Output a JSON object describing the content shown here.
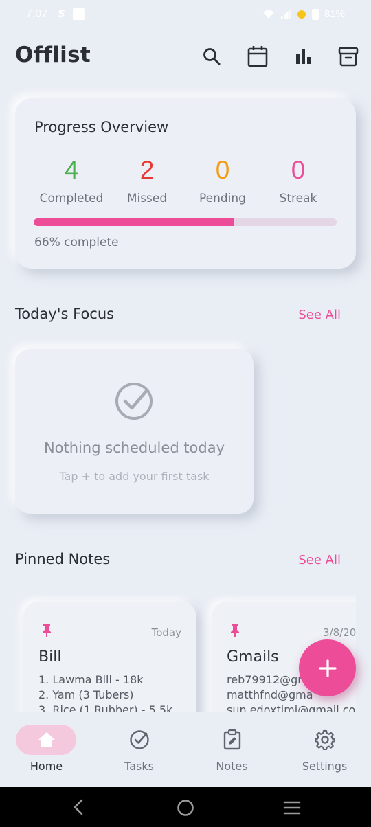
{
  "status_bar": {
    "time": "7:07",
    "battery": "81%"
  },
  "app": {
    "title": "Offlist"
  },
  "progress": {
    "title": "Progress Overview",
    "stats": [
      {
        "value": "4",
        "label": "Completed",
        "color": "#4CAF50"
      },
      {
        "value": "2",
        "label": "Missed",
        "color": "#E53935"
      },
      {
        "value": "0",
        "label": "Pending",
        "color": "#F39C12"
      },
      {
        "value": "0",
        "label": "Streak",
        "color": "#EC4C98"
      }
    ],
    "percent": 66,
    "percent_text": "66% complete"
  },
  "focus": {
    "title": "Today's Focus",
    "see_all": "See All",
    "empty_title": "Nothing scheduled today",
    "empty_hint": "Tap + to add your first task"
  },
  "pinned": {
    "title": "Pinned Notes",
    "see_all": "See All",
    "notes": [
      {
        "date": "Today",
        "title": "Bill",
        "lines": [
          "1. Lawma Bill - 18k",
          "2. Yam (3 Tubers)",
          "3. Rice (1 Rubber) - 5.5k"
        ]
      },
      {
        "date": "3/8/20",
        "title": "Gmails",
        "lines": [
          "reb79912@gr",
          "matthfnd@gma",
          "sun.edoxtimi@gmail.cor"
        ]
      }
    ]
  },
  "nav": {
    "items": [
      {
        "label": "Home",
        "icon": "home-icon",
        "active": true
      },
      {
        "label": "Tasks",
        "icon": "check-circle-icon",
        "active": false
      },
      {
        "label": "Notes",
        "icon": "clipboard-edit-icon",
        "active": false
      },
      {
        "label": "Settings",
        "icon": "gear-icon",
        "active": false
      }
    ]
  },
  "colors": {
    "accent": "#EC4C98",
    "background": "#E9EDF4"
  }
}
